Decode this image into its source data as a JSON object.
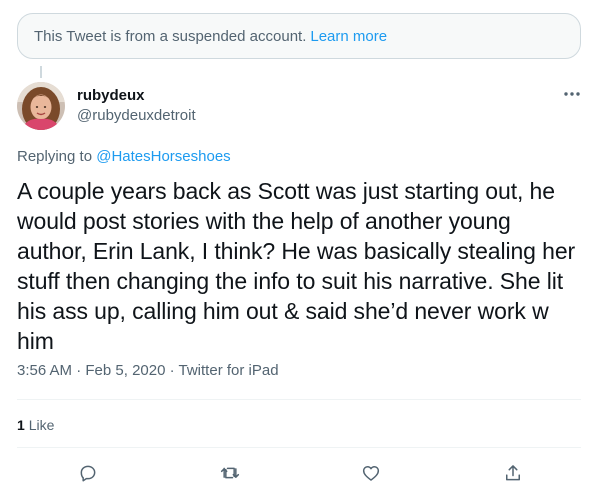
{
  "notice": {
    "text": "This Tweet is from a suspended account.",
    "link": "Learn more"
  },
  "author": {
    "name": "rubydeux",
    "handle": "@rubydeuxdetroit"
  },
  "reply": {
    "prefix": "Replying to",
    "mention": "@HatesHorseshoes"
  },
  "tweet": {
    "text": "A couple years back as Scott was just starting out, he would post stories with the help of another young author, Erin Lank, I think? He was basically stealing her stuff then changing the info to suit his narrative. She lit his ass up, calling him out & said she’d never work w him"
  },
  "meta": {
    "time": "3:56 AM",
    "sep1": " · ",
    "date": "Feb 5, 2020",
    "sep2": " · ",
    "source": "Twitter for iPad"
  },
  "stats": {
    "like_count": "1",
    "like_label": "Like"
  },
  "icons": {
    "more": "more-horizontal-icon",
    "reply": "reply-icon",
    "retweet": "retweet-icon",
    "like": "heart-icon",
    "share": "share-icon"
  },
  "colors": {
    "accent": "#1d9bf0",
    "secondary_text": "#536471",
    "primary_text": "#0f1419",
    "notice_bg": "#f7f9f9"
  }
}
